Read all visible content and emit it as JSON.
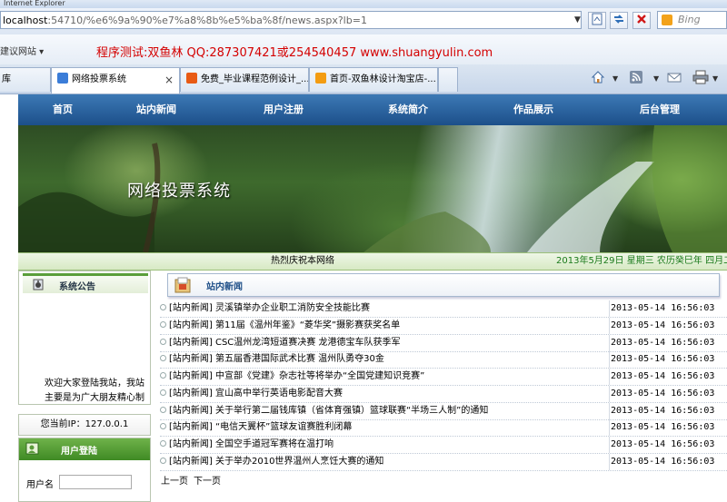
{
  "browser": {
    "window_title": "Internet Explorer",
    "address_host": "localhost",
    "address_rest": ":54710/%e6%9a%90%e7%a8%8b%e5%ba%8f/news.aspx?lb=1",
    "search_placeholder": "Bing",
    "suggested_sites": "建议网站 ▾",
    "fav_banner": "程序测试:双鱼林 QQ:287307421或254540457 www.shuangyulin.com",
    "tabs": [
      {
        "label": "库",
        "active": false
      },
      {
        "label": "网络投票系统",
        "active": true
      },
      {
        "label": "免费_毕业课程范例设计_...",
        "active": false
      },
      {
        "label": "首页-双鱼林设计淘宝店-...",
        "active": false
      }
    ],
    "colors": {
      "tab_icon_ie": "#3b7dd8",
      "tab_icon_taobao": "#e85a14",
      "tab_icon_rss": "#f39c12"
    }
  },
  "nav": {
    "items": [
      "首页",
      "站内新闻",
      "用户注册",
      "系统简介",
      "作品展示",
      "后台管理"
    ]
  },
  "banner": {
    "title": "网络投票系统"
  },
  "marquee": {
    "left_text": "热烈庆祝本网络",
    "date_text": "2013年5月29日  星期三  农历癸巳年  四月二十"
  },
  "sidebar": {
    "notice_title": "系统公告",
    "notice_text": "欢迎大家登陆我站，我站主要是为广大朋友精心制",
    "ip_text": "您当前IP：127.0.0.1",
    "login_title": "用户登陆",
    "username_label": "用户名"
  },
  "news": {
    "title": "站内新闻",
    "items": [
      {
        "title": "[站内新闻] 灵溪镇举办企业职工消防安全技能比赛",
        "time": "2013-05-14 16:56:03"
      },
      {
        "title": "[站内新闻] 第11届《温州年鉴》“菱华奖”摄影赛获奖名单",
        "time": "2013-05-14 16:56:03"
      },
      {
        "title": "[站内新闻] CSC温州龙湾短道赛决赛 龙港德宝车队获季军",
        "time": "2013-05-14 16:56:03"
      },
      {
        "title": "[站内新闻] 第五届香港国际武术比赛 温州队勇夺30金",
        "time": "2013-05-14 16:56:03"
      },
      {
        "title": "[站内新闻] 中宣部《党建》杂志社等将举办“全国党建知识竞赛”",
        "time": "2013-05-14 16:56:03"
      },
      {
        "title": "[站内新闻] 宜山高中举行英语电影配音大赛",
        "time": "2013-05-14 16:56:03"
      },
      {
        "title": "[站内新闻] 关于举行第二届钱库镇（省体育强镇）篮球联赛“半场三人制”的通知",
        "time": "2013-05-14 16:56:03"
      },
      {
        "title": "[站内新闻] “电信天翼杯”篮球友谊赛胜利闭幕",
        "time": "2013-05-14 16:56:03"
      },
      {
        "title": "[站内新闻] 全国空手道冠军赛将在温打响",
        "time": "2013-05-14 16:56:03"
      },
      {
        "title": "[站内新闻] 关于举办2010世界温州人烹饪大赛的通知",
        "time": "2013-05-14 16:56:03"
      }
    ],
    "pager": {
      "prev": "上一页",
      "next": "下一页"
    }
  }
}
